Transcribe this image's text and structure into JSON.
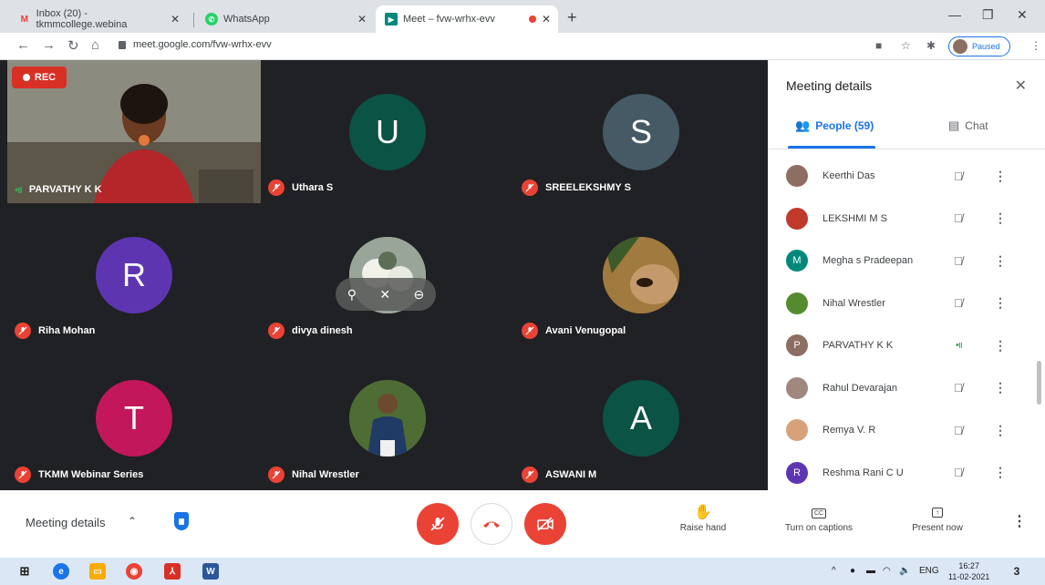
{
  "browser": {
    "tabs": [
      {
        "title": "Inbox (20) - tkmmcollege.webina",
        "icon": "gmail-icon"
      },
      {
        "title": "WhatsApp",
        "icon": "whatsapp-icon"
      },
      {
        "title": "Meet – fvw-wrhx-evv",
        "icon": "meet-icon",
        "active": true
      }
    ],
    "url": "meet.google.com/fvw-wrhx-evv",
    "profile_status": "Paused"
  },
  "grid": {
    "rec_label": "REC",
    "tiles": [
      {
        "name": "PARVATHY K K",
        "kind": "video",
        "speaking": true
      },
      {
        "name": "Uthara S",
        "initial": "U",
        "color": "#0b5345",
        "muted": true
      },
      {
        "name": "SREELEKSHMY S",
        "initial": "S",
        "color": "#455a64",
        "muted": true
      },
      {
        "name": "Riha Mohan",
        "initial": "R",
        "color": "#5e35b1",
        "muted": true
      },
      {
        "name": "divya dinesh",
        "kind": "photo",
        "muted": true
      },
      {
        "name": "Avani Venugopal",
        "kind": "photo",
        "muted": true
      },
      {
        "name": "TKMM Webinar Series",
        "initial": "T",
        "color": "#c2185b",
        "muted": true
      },
      {
        "name": "Nihal Wrestler",
        "kind": "photo",
        "muted": true
      },
      {
        "name": "ASWANI M",
        "initial": "A",
        "color": "#0b5345",
        "muted": true
      }
    ]
  },
  "panel": {
    "title": "Meeting details",
    "tabs": {
      "people": "People (59)",
      "chat": "Chat"
    },
    "people": [
      {
        "name": "Keerthi Das",
        "avatar": "photo",
        "color": "#8d6e63"
      },
      {
        "name": "LEKSHMI M S",
        "avatar": "photo",
        "color": "#c0392b"
      },
      {
        "name": "Megha s Pradeepan",
        "initial": "M",
        "color": "#00897b"
      },
      {
        "name": "Nihal Wrestler",
        "avatar": "photo",
        "color": "#558b2f"
      },
      {
        "name": "PARVATHY K K",
        "initial": "P",
        "color": "#8d6e63",
        "speaking": true
      },
      {
        "name": "Rahul Devarajan",
        "avatar": "photo",
        "color": "#a1887f"
      },
      {
        "name": "Remya V. R",
        "avatar": "photo",
        "color": "#d7a27a"
      },
      {
        "name": "Reshma Rani C U",
        "initial": "R",
        "color": "#5e35b1"
      }
    ]
  },
  "controls": {
    "meeting_details": "Meeting details",
    "raise_hand": "Raise hand",
    "captions": "Turn on captions",
    "present": "Present now"
  },
  "taskbar": {
    "lang": "ENG",
    "time": "16:27",
    "date": "11-02-2021",
    "notifications": "3"
  }
}
